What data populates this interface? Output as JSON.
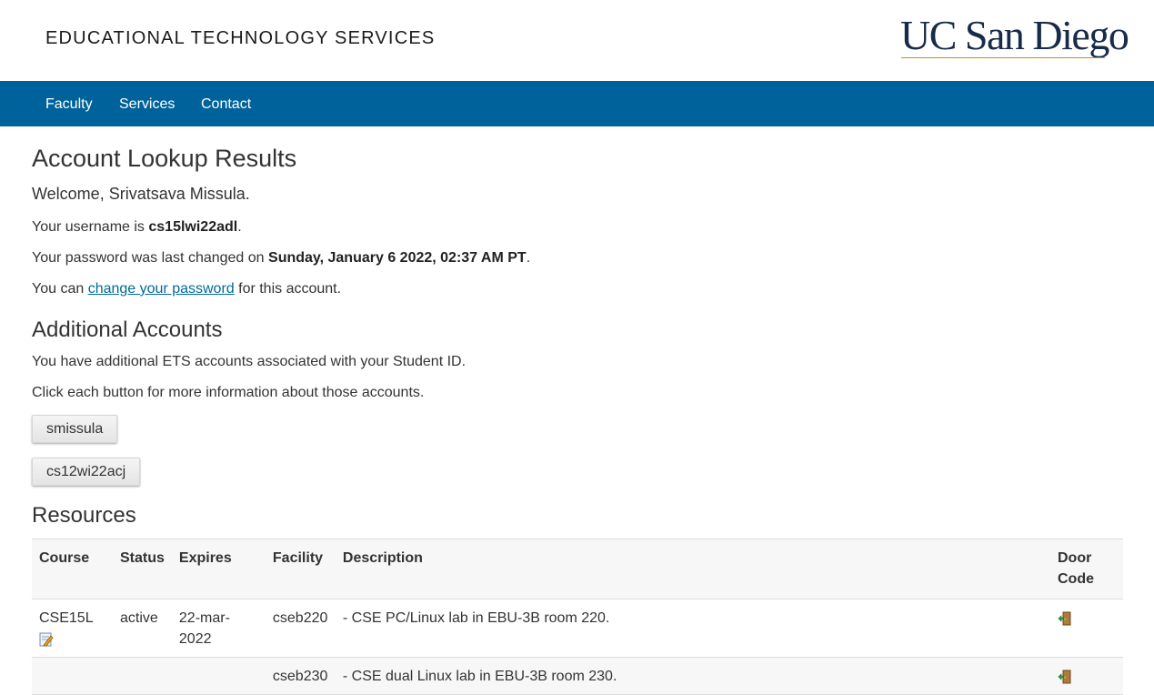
{
  "header": {
    "site_title": "EDUCATIONAL TECHNOLOGY SERVICES",
    "logo_text": "UC San Diego"
  },
  "nav": {
    "items": [
      {
        "label": "Faculty"
      },
      {
        "label": "Services"
      },
      {
        "label": "Contact"
      }
    ]
  },
  "main": {
    "title": "Account Lookup Results",
    "welcome": "Welcome, Srivatsava Missula.",
    "username_prefix": "Your username is ",
    "username": "cs15lwi22adl",
    "username_suffix": ".",
    "password_prefix": "Your password was last changed on ",
    "password_date": "Sunday, January 6 2022, 02:37 AM PT",
    "password_suffix": ".",
    "change_prefix": "You can ",
    "change_link": "change your password",
    "change_suffix": " for this account."
  },
  "additional": {
    "title": "Additional Accounts",
    "line1": "You have additional ETS accounts associated with your Student ID.",
    "line2": "Click each button for more information about those accounts.",
    "buttons": [
      {
        "label": "smissula"
      },
      {
        "label": "cs12wi22acj"
      }
    ]
  },
  "resources": {
    "title": "Resources",
    "columns": [
      "Course",
      "Status",
      "Expires",
      "Facility",
      "Description",
      "Door Code"
    ],
    "rows": [
      {
        "course": "CSE15L",
        "status": "active",
        "expires": "22-mar-2022",
        "facility": "cseb220",
        "description": "- CSE PC/Linux lab in EBU-3B room 220.",
        "course_icon": "edit-icon",
        "door_icon": "door-icon"
      },
      {
        "course": "",
        "status": "",
        "expires": "",
        "facility": "cseb230",
        "description": "- CSE dual Linux lab in EBU-3B room 230.",
        "door_icon": "door-icon"
      }
    ]
  },
  "colors": {
    "nav_bg": "#00629b",
    "logo_navy": "#182b49",
    "logo_gold": "#c69214",
    "link": "#006a96"
  }
}
